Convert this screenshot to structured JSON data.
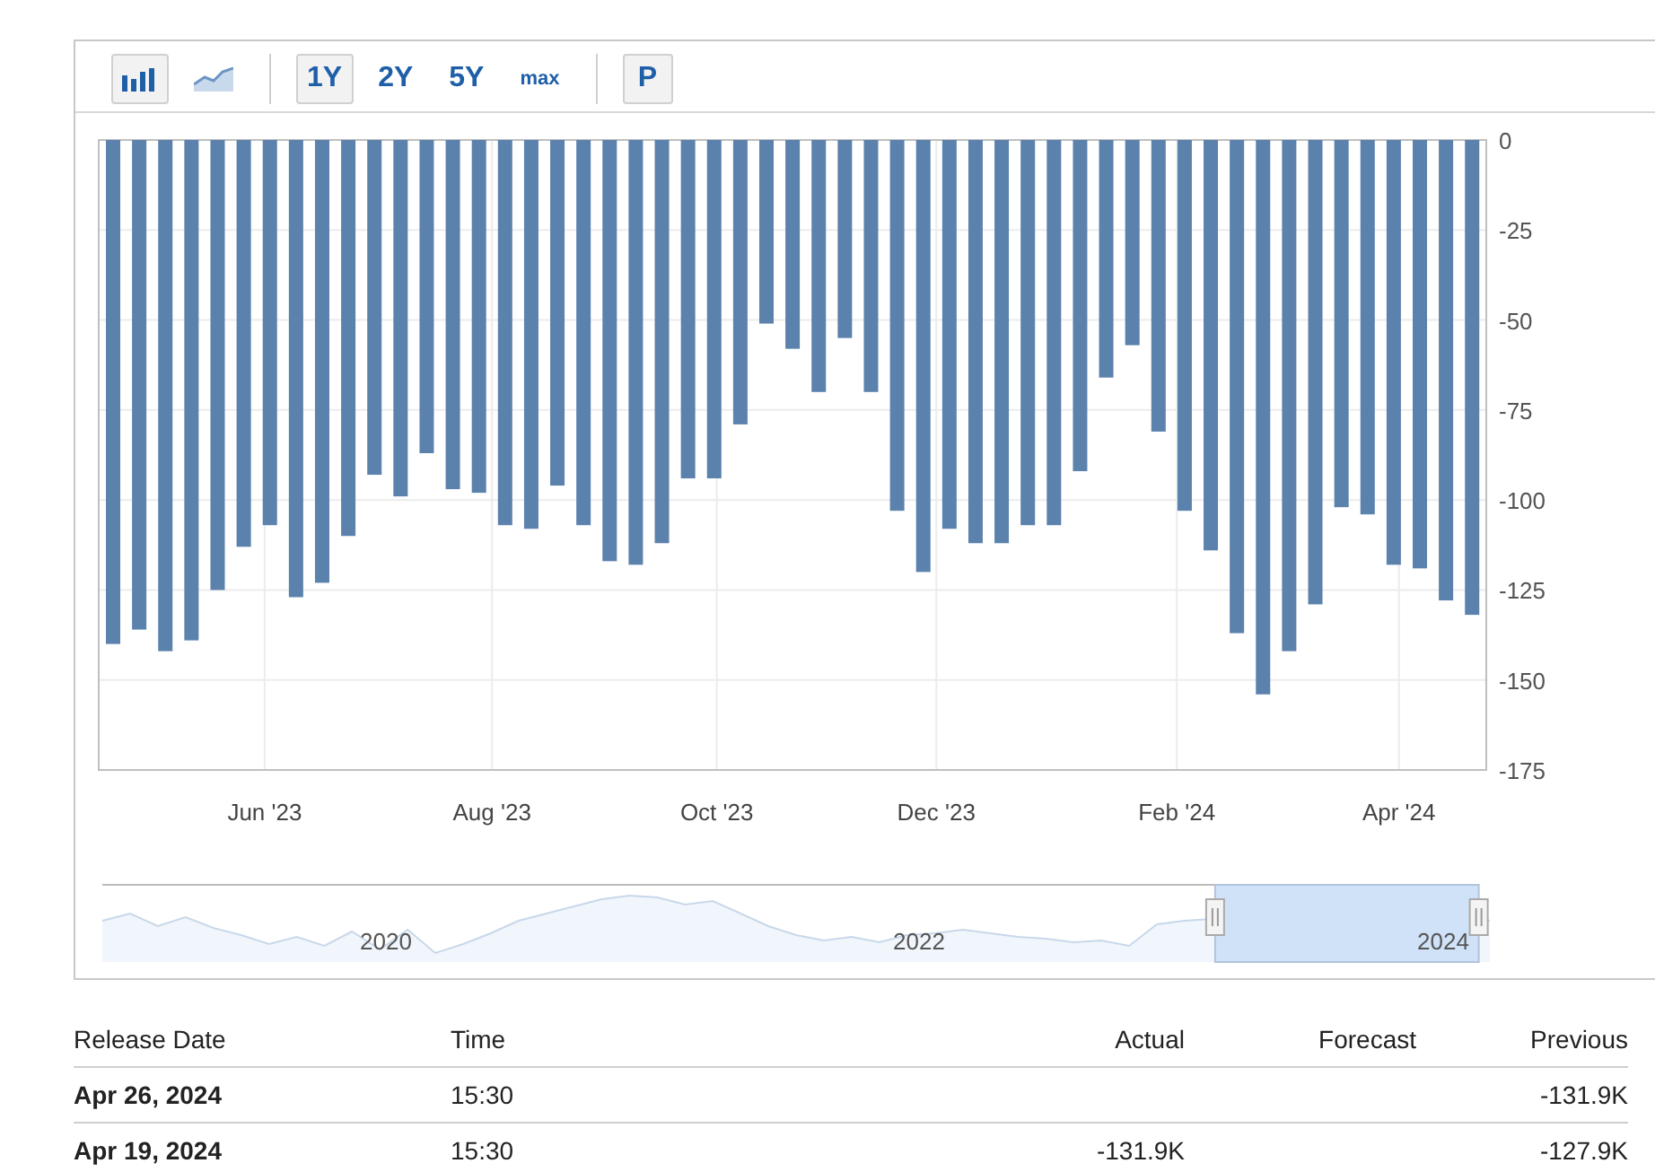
{
  "toolbar": {
    "chart_types": [
      {
        "kind": "bar",
        "selected": true
      },
      {
        "kind": "line",
        "selected": false
      }
    ],
    "ranges": [
      {
        "label": "1Y",
        "selected": true
      },
      {
        "label": "2Y",
        "selected": false
      },
      {
        "label": "5Y",
        "selected": false
      },
      {
        "label": "max",
        "selected": false
      }
    ],
    "extra": [
      {
        "label": "P",
        "selected": true
      }
    ]
  },
  "chart": {
    "chart_data": {
      "type": "bar",
      "color": "#5b81ad",
      "values": [
        -140,
        -136,
        -142,
        -139,
        -125,
        -113,
        -107,
        -127,
        -123,
        -110,
        -93,
        -99,
        -87,
        -97,
        -98,
        -107,
        -108,
        -96,
        -107,
        -117,
        -118,
        -112,
        -94,
        -94,
        -79,
        -51,
        -58,
        -70,
        -55,
        -70,
        -103,
        -120,
        -108,
        -112,
        -112,
        -107,
        -107,
        -92,
        -66,
        -57,
        -81,
        -103,
        -114,
        -137,
        -154,
        -142,
        -129,
        -102,
        -104,
        -118,
        -119,
        -127.9,
        -131.9
      ],
      "ylim": [
        -175,
        0
      ],
      "yticks": [
        0,
        -25,
        -50,
        -75,
        -100,
        -125,
        -150,
        -175
      ],
      "grid": true
    },
    "x_axis_labels": [
      "Jun '23",
      "Aug '23",
      "Oct '23",
      "Dec '23",
      "Feb '24",
      "Apr '24"
    ]
  },
  "navigator": {
    "labels": [
      "2020",
      "2022",
      "2024"
    ]
  },
  "table": {
    "columns": [
      "Release Date",
      "Time",
      "Actual",
      "Forecast",
      "Previous"
    ],
    "rows": [
      [
        "Apr 26, 2024",
        "15:30",
        "",
        "",
        "-131.9K"
      ],
      [
        "Apr 19, 2024",
        "15:30",
        "-131.9K",
        "",
        "-127.9K"
      ]
    ]
  }
}
